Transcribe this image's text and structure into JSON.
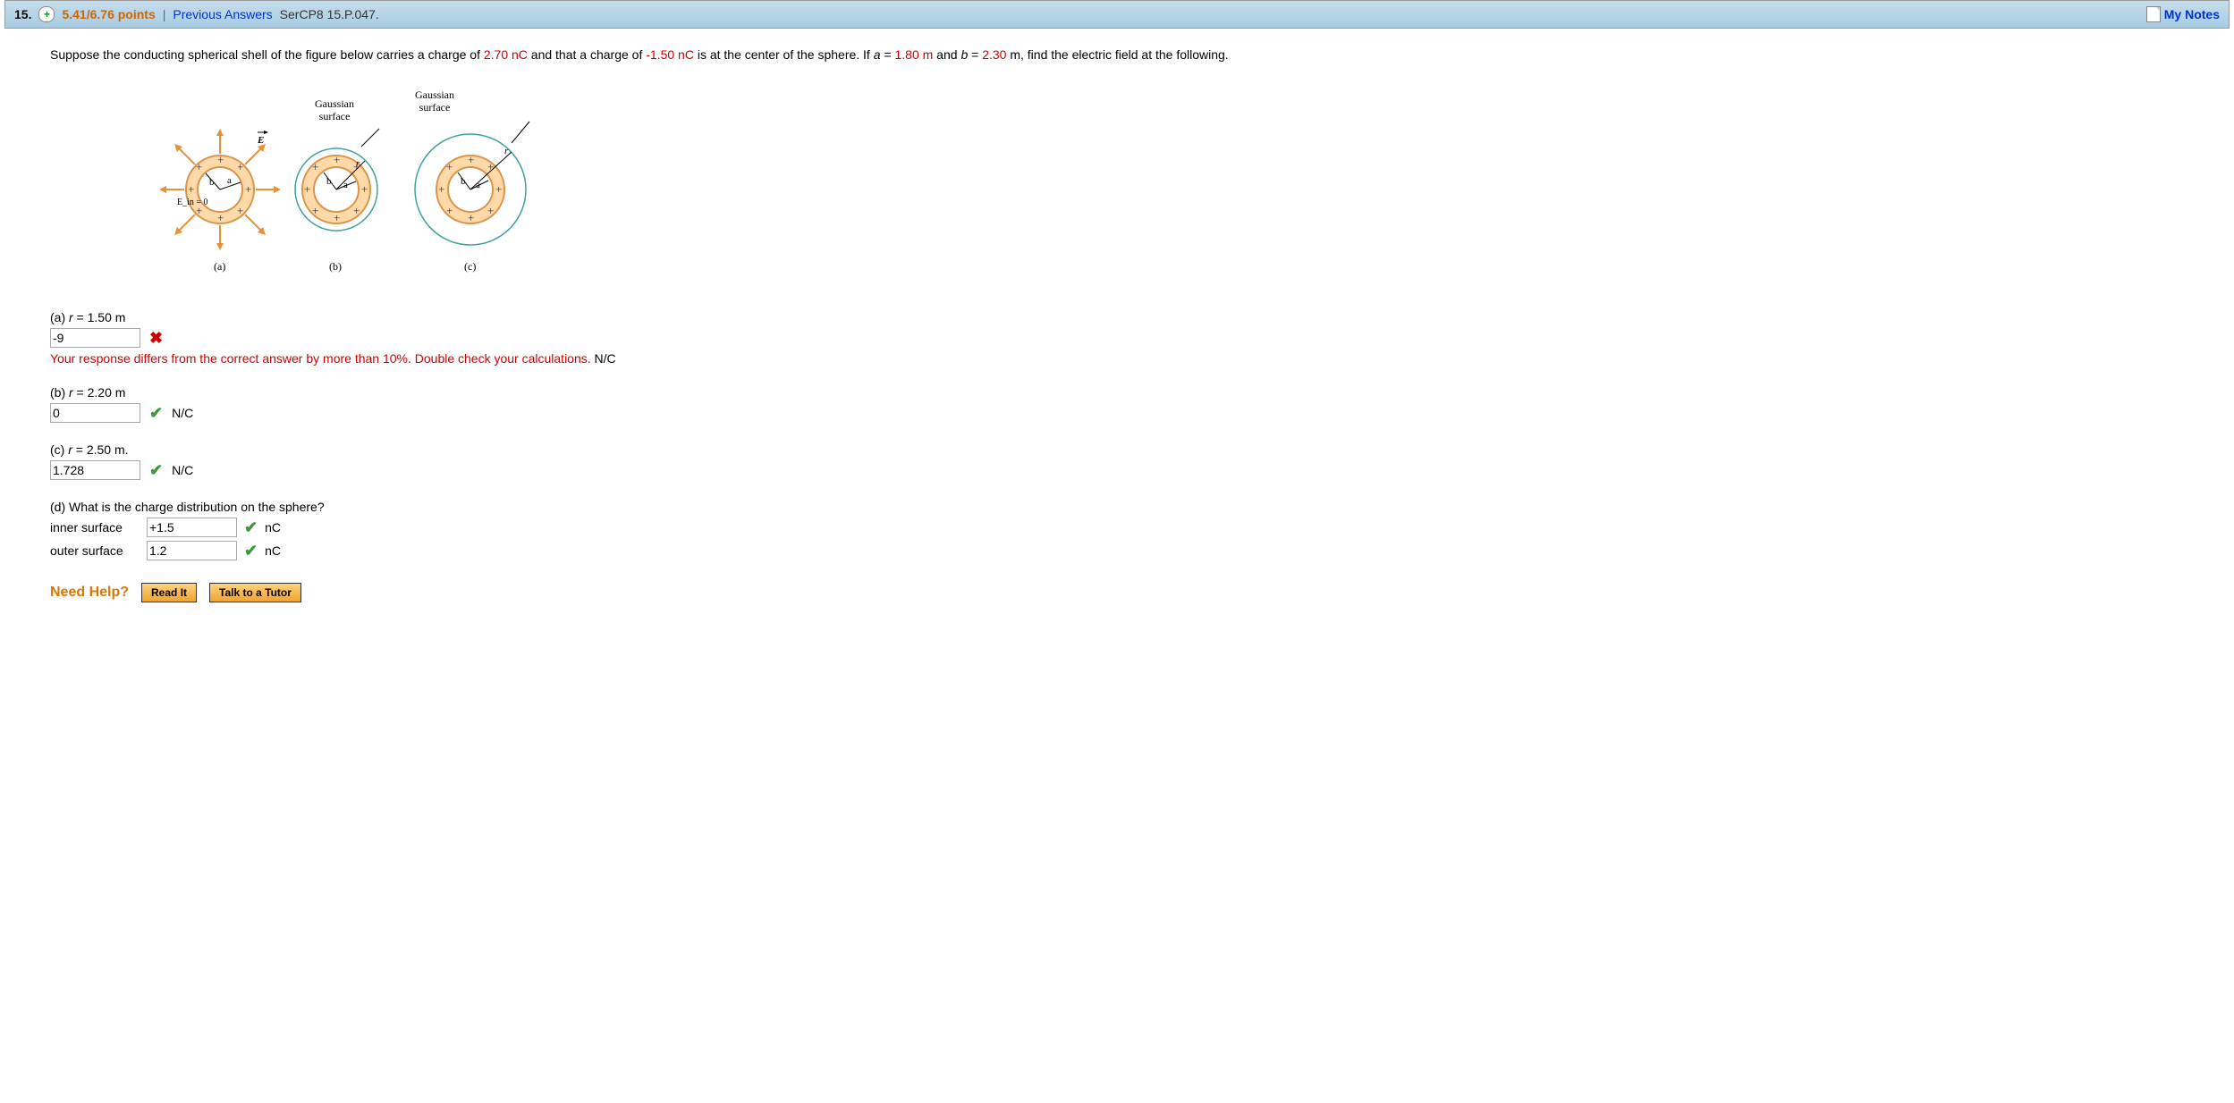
{
  "header": {
    "question_number": "15.",
    "plus": "+",
    "points": "5.41/6.76 points",
    "separator": "|",
    "previous_link": "Previous Answers",
    "source": "SerCP8 15.P.047.",
    "my_notes": "My Notes"
  },
  "problem": {
    "text1": "Suppose the conducting spherical shell of the figure below carries a charge of ",
    "val1": "2.70 nC",
    "text2": " and that a charge of ",
    "val2": "-1.50 nC",
    "text3": " is at the center of the sphere. If ",
    "a_var": "a",
    "eq1": " = ",
    "val3": "1.80 m",
    "text4": " and ",
    "b_var": "b",
    "eq2": " = ",
    "val4": "2.30",
    "text5": " m, find the electric field at the following."
  },
  "figure": {
    "label_gaussian_b": "Gaussian surface",
    "label_gaussian_c": "Gaussian surface",
    "e_vec": "E",
    "ein_eq": "E_in = 0",
    "a_lbl": "a",
    "b_lbl": "b",
    "r_lbl": "r",
    "sub_a": "(a)",
    "sub_b": "(b)",
    "sub_c": "(c)"
  },
  "parts": {
    "a": {
      "label_prefix": "(a) ",
      "r_var": "r",
      "eq": " = 1.50 m",
      "value": "-9",
      "feedback": "Your response differs from the correct answer by more than 10%. Double check your calculations.",
      "unit": " N/C"
    },
    "b": {
      "label_prefix": "(b) ",
      "r_var": "r",
      "eq": " = 2.20 m",
      "value": "0",
      "unit": "N/C"
    },
    "c": {
      "label_prefix": "(c) ",
      "r_var": "r",
      "eq": " = 2.50 m.",
      "value": "1.728",
      "unit": "N/C"
    },
    "d": {
      "label": "(d) What is the charge distribution on the sphere?",
      "inner_label": "inner surface",
      "inner_value": "+1.5",
      "outer_label": "outer surface",
      "outer_value": "1.2",
      "unit": "nC"
    }
  },
  "help": {
    "label": "Need Help?",
    "read_it": "Read It",
    "talk": "Talk to a Tutor"
  },
  "marks": {
    "correct": "✔",
    "incorrect": "✖"
  }
}
